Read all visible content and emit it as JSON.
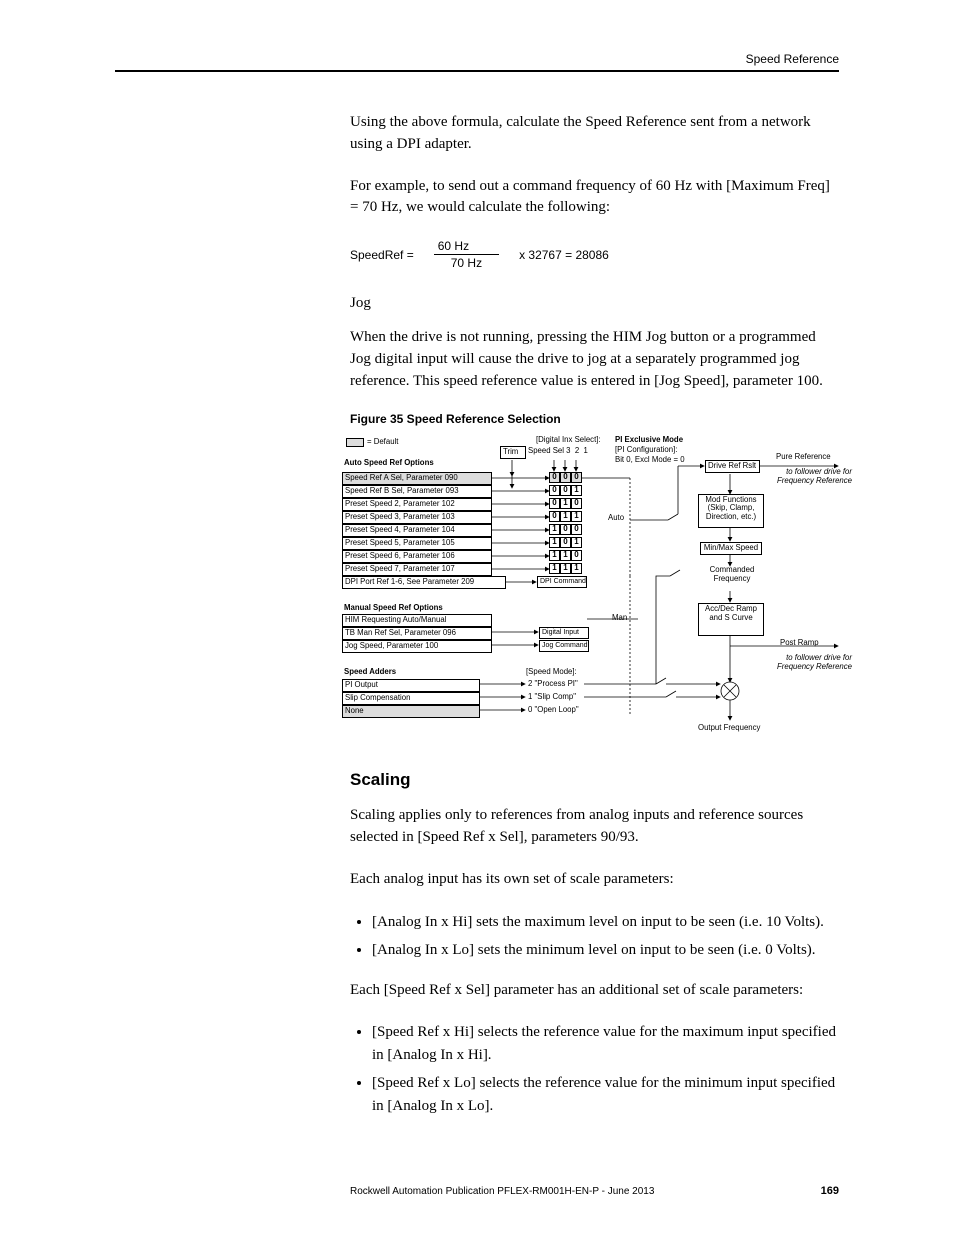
{
  "header": {
    "title": "Speed Reference"
  },
  "para1": "Using the above formula, calculate the Speed Reference sent from a network using a DPI adapter.",
  "para2": "For example, to send out a command frequency of 60 Hz with [Maximum Freq] = 70 Hz, we would calculate the following:",
  "formula": {
    "label": "SpeedRef =",
    "num": "60 Hz",
    "den": "70 Hz",
    "rhs": "x 32767 = 28086"
  },
  "jog": {
    "head": "Jog",
    "text": "When the drive is not running, pressing the HIM Jog button or a programmed Jog digital input will cause the drive to jog at a separately programmed jog reference. This speed reference value is entered in [Jog Speed], parameter 100."
  },
  "figcaption": "Figure 35   Speed Reference Selection",
  "diagram": {
    "legend": "= Default",
    "trim": "Trim",
    "digital_inx": "[Digital Inx Select]:",
    "speed_sel": "Speed Sel",
    "speed_sel_cols": [
      "3",
      "2",
      "1"
    ],
    "sections": {
      "auto": "Auto Speed Ref Options",
      "manual": "Manual Speed Ref Options",
      "adders": "Speed Adders"
    },
    "auto_rows": [
      {
        "label": "Speed Ref A Sel, Parameter 090",
        "g": true,
        "bits": [
          "0",
          "0",
          "0"
        ]
      },
      {
        "label": "Speed Ref B Sel, Parameter 093",
        "g": false,
        "bits": [
          "0",
          "0",
          "1"
        ]
      },
      {
        "label": "Preset Speed 2, Parameter 102",
        "g": false,
        "bits": [
          "0",
          "1",
          "0"
        ]
      },
      {
        "label": "Preset Speed 3, Parameter 103",
        "g": false,
        "bits": [
          "0",
          "1",
          "1"
        ]
      },
      {
        "label": "Preset Speed 4, Parameter 104",
        "g": false,
        "bits": [
          "1",
          "0",
          "0"
        ]
      },
      {
        "label": "Preset Speed 5, Parameter 105",
        "g": false,
        "bits": [
          "1",
          "0",
          "1"
        ]
      },
      {
        "label": "Preset Speed 6, Parameter 106",
        "g": false,
        "bits": [
          "1",
          "1",
          "0"
        ]
      },
      {
        "label": "Preset Speed 7, Parameter 107",
        "g": false,
        "bits": [
          "1",
          "1",
          "1"
        ]
      },
      {
        "label": "DPI Port Ref 1-6, See Parameter 209",
        "g": false,
        "dpi": "DPI Command"
      }
    ],
    "manual_rows": [
      {
        "label": "HIM Requesting Auto/Manual",
        "target": ""
      },
      {
        "label": "TB Man Ref Sel, Parameter 096",
        "target": "Digital Input"
      },
      {
        "label": "Jog Speed, Parameter 100",
        "target": "Jog Command"
      }
    ],
    "adders": [
      {
        "label": "PI Output",
        "mode": "2 \"Process PI\""
      },
      {
        "label": "Slip Compensation",
        "mode": "1 \"Slip Comp\""
      },
      {
        "label": "None",
        "g": true,
        "mode": "0 \"Open Loop\""
      }
    ],
    "speed_mode": "[Speed Mode]:",
    "pi_excl": "PI Exclusive Mode",
    "pi_conf": "[PI Configuration]:",
    "pi_bit": "Bit 0, Excl Mode = 0",
    "man_label": "Man",
    "auto_label": "Auto",
    "drive_ref_rslt": "Drive Ref Rslt",
    "pure_ref": "Pure Reference",
    "to_follower1": "to follower drive for Frequency Reference",
    "mod_func": "Mod Functions (Skip, Clamp, Direction, etc.)",
    "minmax": "Min/Max Speed",
    "commanded": "Commanded Frequency",
    "acc_dec": "Acc/Dec Ramp and S Curve",
    "post_ramp": "Post Ramp",
    "to_follower2": "to follower drive for Frequency Reference",
    "output_freq": "Output Frequency"
  },
  "scaling": {
    "head": "Scaling",
    "p1": "Scaling applies only to references from analog inputs and reference sources selected in [Speed Ref x Sel], parameters 90/93.",
    "p2": "Each analog input has its own set of scale parameters:",
    "b1": "[Analog In x Hi] sets the maximum level on input to be seen (i.e. 10 Volts).",
    "b2": "[Analog In x Lo] sets the minimum level on input to be seen (i.e. 0 Volts).",
    "p3": "Each [Speed Ref x Sel] parameter has an additional set of scale parameters:",
    "b3": "[Speed Ref x Hi] selects the reference value for the maximum input specified in [Analog In x Hi].",
    "b4": "[Speed Ref x Lo] selects the reference value for the minimum input specified in [Analog In x Lo]."
  },
  "footer": {
    "pub": "Rockwell Automation Publication PFLEX-RM001H-EN-P - June 2013",
    "page": "169"
  }
}
